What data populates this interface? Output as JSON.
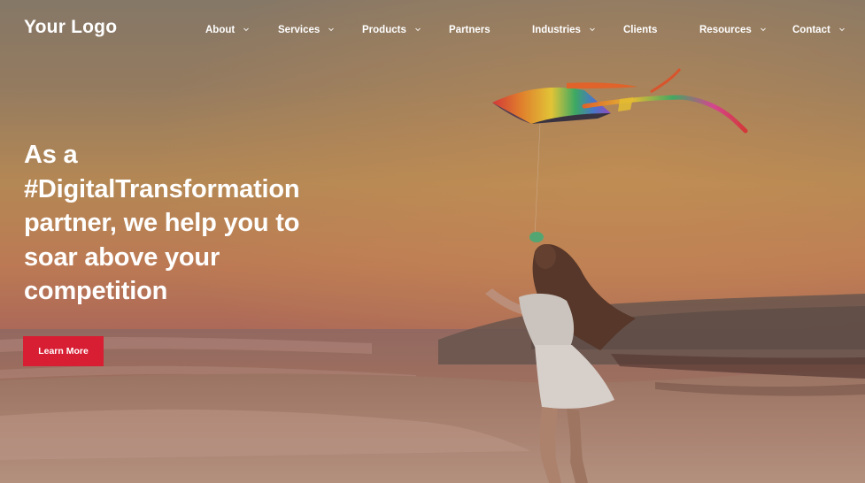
{
  "brand": {
    "logo_text": "Your Logo"
  },
  "nav": {
    "items": [
      {
        "label": "About",
        "has_dropdown": true
      },
      {
        "label": "Services",
        "has_dropdown": true
      },
      {
        "label": "Products",
        "has_dropdown": true
      },
      {
        "label": "Partners",
        "has_dropdown": false
      },
      {
        "label": "Industries",
        "has_dropdown": true
      },
      {
        "label": "Clients",
        "has_dropdown": false
      },
      {
        "label": "Resources",
        "has_dropdown": true
      },
      {
        "label": "Contact",
        "has_dropdown": true
      }
    ]
  },
  "hero": {
    "headline_lines": [
      "As a",
      "#DigitalTransformation",
      "partner, we help you to",
      "soar above your",
      "competition"
    ],
    "cta_label": "Learn More",
    "background_image": "sunset-beach-girl-flying-kite"
  },
  "colors": {
    "cta_background": "#d81e33",
    "text": "#ffffff",
    "sky_top": "#8f7f6c",
    "sky_mid": "#c99257",
    "horizon": "#c0705b"
  }
}
